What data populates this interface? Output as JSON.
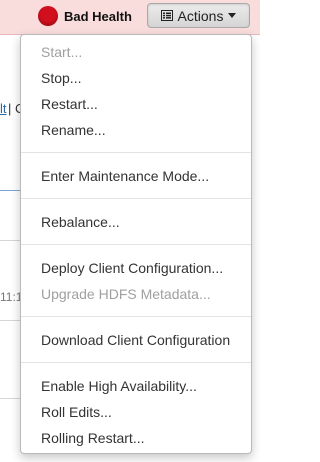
{
  "header": {
    "health_label": "Bad Health",
    "health_color": "#d20f1d",
    "actions_label": "Actions",
    "actions_icon": "list-icon"
  },
  "background": {
    "link_fragment": "lt",
    "separator": "| C",
    "time_fragment": "11:1"
  },
  "menu": {
    "items": [
      {
        "label": "Start...",
        "enabled": false
      },
      {
        "label": "Stop...",
        "enabled": true
      },
      {
        "label": "Restart...",
        "enabled": true
      },
      {
        "label": "Rename...",
        "enabled": true
      },
      {
        "label": "Enter Maintenance Mode...",
        "enabled": true
      },
      {
        "label": "Rebalance...",
        "enabled": true
      },
      {
        "label": "Deploy Client Configuration...",
        "enabled": true
      },
      {
        "label": "Upgrade HDFS Metadata...",
        "enabled": false
      },
      {
        "label": "Download Client Configuration",
        "enabled": true
      },
      {
        "label": "Enable High Availability...",
        "enabled": true
      },
      {
        "label": "Roll Edits...",
        "enabled": true
      },
      {
        "label": "Rolling Restart...",
        "enabled": true
      }
    ]
  }
}
